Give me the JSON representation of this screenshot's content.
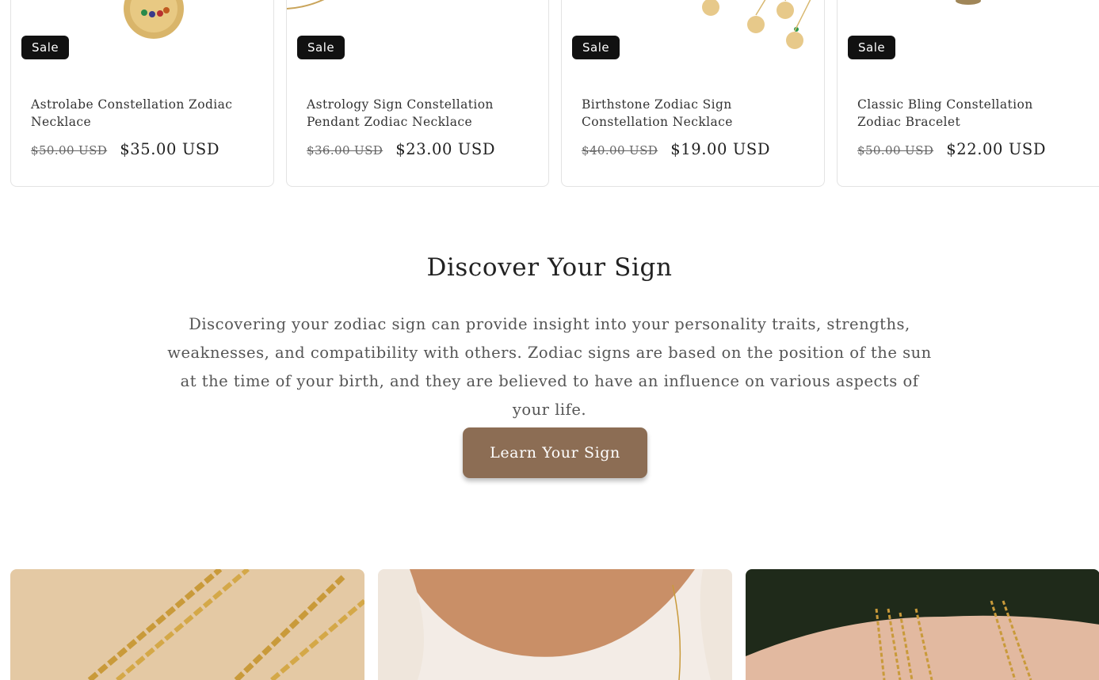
{
  "products": [
    {
      "badge": "Sale",
      "title": "Astrolabe Constellation Zodiac Necklace",
      "old_price": "$50.00 USD",
      "price": "$35.00 USD"
    },
    {
      "badge": "Sale",
      "title": "Astrology Sign Constellation Pendant Zodiac Necklace",
      "old_price": "$36.00 USD",
      "price": "$23.00 USD"
    },
    {
      "badge": "Sale",
      "title": "Birthstone Zodiac Sign Constellation Necklace",
      "old_price": "$40.00 USD",
      "price": "$19.00 USD"
    },
    {
      "badge": "Sale",
      "title": "Classic Bling Constellation Zodiac Bracelet",
      "old_price": "$50.00 USD",
      "price": "$22.00 USD"
    }
  ],
  "discover": {
    "heading": "Discover Your Sign",
    "body": "Discovering your zodiac sign can provide insight into your personality traits, strengths, weaknesses, and compatibility with others. Zodiac signs are based on the position of the sun at the time of your birth, and they are believed to have an influence on various aspects of your life.",
    "button_label": "Learn Your Sign"
  },
  "colors": {
    "button": "#8c6d54",
    "badge": "#111111"
  }
}
